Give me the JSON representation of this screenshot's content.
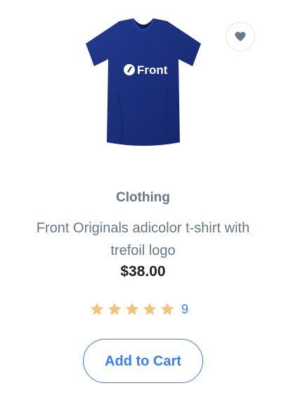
{
  "product": {
    "image": {
      "shirt_color": "#1d2f7a",
      "logo_text": "Front"
    },
    "wishlist_icon": "heart-icon",
    "category": "Clothing",
    "title": "Front Originals adicolor t-shirt with trefoil logo",
    "price": "$38.00",
    "rating": {
      "stars": 5,
      "max_stars": 5,
      "star_color": "#f4c27c",
      "review_count": "9"
    },
    "add_to_cart_label": "Add to Cart"
  },
  "colors": {
    "accent": "#377dff",
    "muted_text": "#677788",
    "heading_text": "#1e2022"
  }
}
